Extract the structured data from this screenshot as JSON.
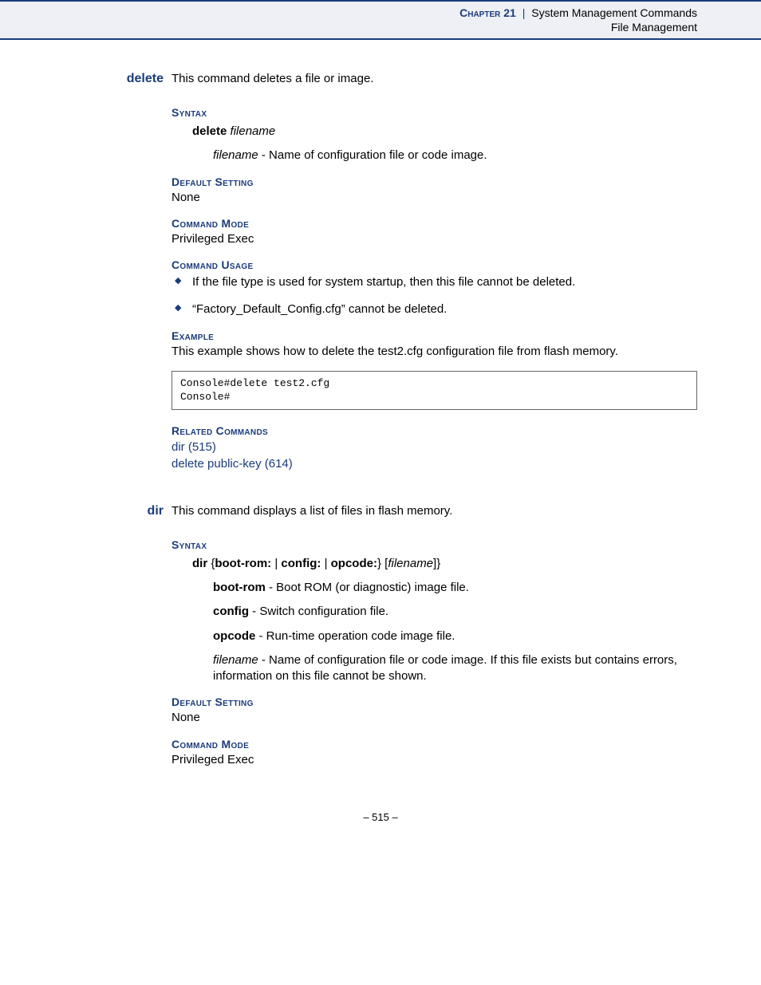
{
  "header": {
    "chapter_label": "Chapter 21",
    "separator": "|",
    "title": "System Management Commands",
    "subtitle": "File Management"
  },
  "delete": {
    "name": "delete",
    "intro": "This command deletes a file or image.",
    "syntax": {
      "heading": "Syntax",
      "cmd": "delete",
      "arg": "filename",
      "arg_label": "filename",
      "arg_desc": " - Name of configuration file or code image."
    },
    "default": {
      "heading": "Default Setting",
      "value": "None"
    },
    "mode": {
      "heading": "Command Mode",
      "value": "Privileged Exec"
    },
    "usage": {
      "heading": "Command Usage",
      "items": [
        "If the file type is used for system startup, then this file cannot be deleted.",
        "“Factory_Default_Config.cfg” cannot be deleted."
      ]
    },
    "example": {
      "heading": "Example",
      "desc": "This example shows how to delete the test2.cfg configuration file from flash memory.",
      "code": "Console#delete test2.cfg\nConsole#"
    },
    "related": {
      "heading": "Related Commands",
      "items": [
        "dir (515)",
        "delete public-key (614)"
      ]
    }
  },
  "dir": {
    "name": "dir",
    "intro": "This command displays a list of files in flash memory.",
    "syntax": {
      "heading": "Syntax",
      "line_cmd": "dir",
      "line_rest_open": " {",
      "opt1": "boot-rom:",
      "pipe": " | ",
      "opt2": "config:",
      "opt3": "opcode:",
      "line_rest_close": "} [",
      "arg": "filename",
      "line_rest_end": "]}",
      "params": [
        {
          "k": "boot-rom",
          "d": " - Boot ROM (or diagnostic) image file.",
          "style": "bold"
        },
        {
          "k": "config",
          "d": " - Switch configuration file.",
          "style": "bold"
        },
        {
          "k": "opcode",
          "d": " - Run-time operation code image file.",
          "style": "bold"
        },
        {
          "k": "filename",
          "d": " - Name of configuration file or code image. If this file exists but contains errors, information on this file cannot be shown.",
          "style": "ital"
        }
      ]
    },
    "default": {
      "heading": "Default Setting",
      "value": "None"
    },
    "mode": {
      "heading": "Command Mode",
      "value": "Privileged Exec"
    }
  },
  "footer": {
    "page": "–  515  –"
  }
}
